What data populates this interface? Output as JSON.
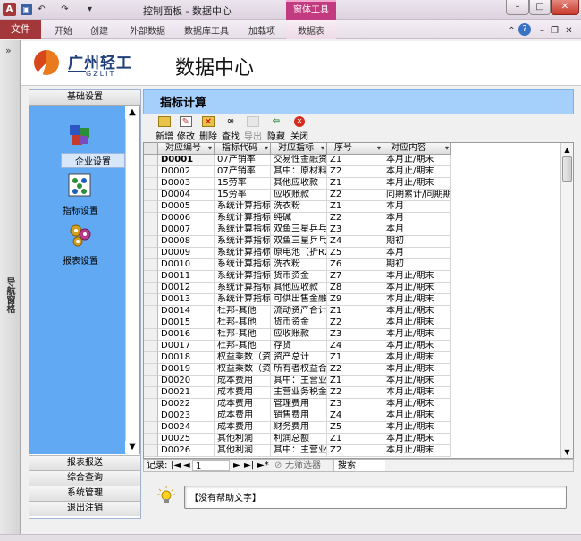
{
  "window": {
    "title": "控制面板 - 数据中心",
    "tools_group": "窗体工具",
    "buttons": {
      "minimize": "–",
      "maximize": "□",
      "close": "✕"
    }
  },
  "ribbon": {
    "file_tab": "文件",
    "tabs": [
      "开始",
      "创建",
      "外部数据",
      "数据库工具",
      "加载项",
      "数据表"
    ],
    "active_tab": "数据表"
  },
  "nav_pane": {
    "label": "导航窗格",
    "toggle": "»"
  },
  "header": {
    "logo_cn": "广州轻工",
    "logo_en": "GZLIT",
    "title": "数据中心"
  },
  "sidebar": {
    "section_title": "基础设置",
    "items": [
      {
        "label": "企业设置",
        "icon": "cubes-icon",
        "selected": true
      },
      {
        "label": "指标设置",
        "icon": "dots-grid-icon",
        "selected": false
      },
      {
        "label": "报表设置",
        "icon": "gears-icon",
        "selected": false
      }
    ],
    "bottom_sections": [
      "报表报送",
      "综合查询",
      "系统管理",
      "退出注销"
    ]
  },
  "panel": {
    "title": "指标计算",
    "toolbar": [
      {
        "label": "新增",
        "icon": "new-folder-icon"
      },
      {
        "label": "修改",
        "icon": "edit-doc-icon"
      },
      {
        "label": "删除",
        "icon": "delete-folder-icon"
      },
      {
        "label": "查找",
        "icon": "binoculars-icon"
      },
      {
        "label": "导出",
        "icon": "export-icon",
        "disabled": true
      },
      {
        "label": "隐藏",
        "icon": "hide-arrow-icon"
      },
      {
        "label": "关闭",
        "icon": "close-red-icon"
      }
    ]
  },
  "grid": {
    "columns": [
      "对应编号",
      "指标代码",
      "对应指标",
      "序号",
      "对应内容"
    ],
    "rows": [
      [
        "D0001",
        "07产销率",
        "交易性金融资",
        "Z1",
        "本月止/期末"
      ],
      [
        "D0002",
        "07产销率",
        "其中：原材料",
        "Z2",
        "本月止/期末"
      ],
      [
        "D0003",
        "15劳率",
        "其他应收款",
        "Z1",
        "本月止/期末"
      ],
      [
        "D0004",
        "15劳率",
        "应收账款",
        "Z2",
        "同期累计/同期期"
      ],
      [
        "D0005",
        "系统计算指标",
        "洗衣粉",
        "Z1",
        "本月"
      ],
      [
        "D0006",
        "系统计算指标",
        "纯碱",
        "Z2",
        "本月"
      ],
      [
        "D0007",
        "系统计算指标",
        "双鱼三星乒乓",
        "Z3",
        "本月"
      ],
      [
        "D0008",
        "系统计算指标",
        "双鱼三星乒乓",
        "Z4",
        "期初"
      ],
      [
        "D0009",
        "系统计算指标",
        "原电池（折R2",
        "Z5",
        "本月"
      ],
      [
        "D0010",
        "系统计算指标",
        "洗衣粉",
        "Z6",
        "期初"
      ],
      [
        "D0011",
        "系统计算指标",
        "货币资金",
        "Z7",
        "本月止/期末"
      ],
      [
        "D0012",
        "系统计算指标",
        "其他应收款",
        "Z8",
        "本月止/期末"
      ],
      [
        "D0013",
        "系统计算指标",
        "可供出售金融",
        "Z9",
        "本月止/期末"
      ],
      [
        "D0014",
        "杜邦-其他",
        "流动资产合计",
        "Z1",
        "本月止/期末"
      ],
      [
        "D0015",
        "杜邦-其他",
        "货币资金",
        "Z2",
        "本月止/期末"
      ],
      [
        "D0016",
        "杜邦-其他",
        "应收账款",
        "Z3",
        "本月止/期末"
      ],
      [
        "D0017",
        "杜邦-其他",
        "存货",
        "Z4",
        "本月止/期末"
      ],
      [
        "D0018",
        "权益乘数（资",
        "资产总计",
        "Z1",
        "本月止/期末"
      ],
      [
        "D0019",
        "权益乘数（资",
        "所有者权益合",
        "Z2",
        "本月止/期末"
      ],
      [
        "D0020",
        "成本费用",
        "其中：主营业",
        "Z1",
        "本月止/期末"
      ],
      [
        "D0021",
        "成本费用",
        "主营业务税金",
        "Z2",
        "本月止/期末"
      ],
      [
        "D0022",
        "成本费用",
        "管理费用",
        "Z3",
        "本月止/期末"
      ],
      [
        "D0023",
        "成本费用",
        "销售费用",
        "Z4",
        "本月止/期末"
      ],
      [
        "D0024",
        "成本费用",
        "财务费用",
        "Z5",
        "本月止/期末"
      ],
      [
        "D0025",
        "其他利润",
        "利润总额",
        "Z1",
        "本月止/期末"
      ],
      [
        "D0026",
        "其他利润",
        "其中：主营业",
        "Z2",
        "本月止/期末"
      ]
    ]
  },
  "record_nav": {
    "label": "记录:",
    "current": "1",
    "filter": "无筛选器",
    "search": "搜索",
    "first": "|◄",
    "prev": "◄",
    "next": "►",
    "last": "►|",
    "new": "►*"
  },
  "help": {
    "text": "【没有帮助文字】"
  }
}
